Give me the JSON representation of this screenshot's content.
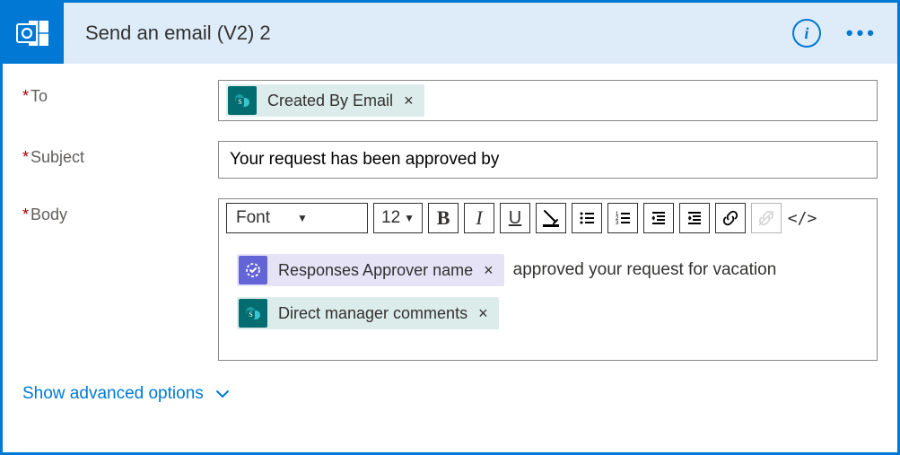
{
  "header": {
    "title": "Send an email (V2) 2"
  },
  "fields": {
    "to_label": "To",
    "subject_label": "Subject",
    "body_label": "Body",
    "subject_value": "Your request has been approved by"
  },
  "tokens": {
    "created_by_email": "Created By Email",
    "responses_approver_name": "Responses Approver name",
    "direct_manager_comments": "Direct manager comments"
  },
  "body_text": {
    "after_approver": " approved your request for vacation"
  },
  "toolbar": {
    "font_label": "Font",
    "font_size": "12"
  },
  "footer": {
    "advanced": "Show advanced options"
  }
}
